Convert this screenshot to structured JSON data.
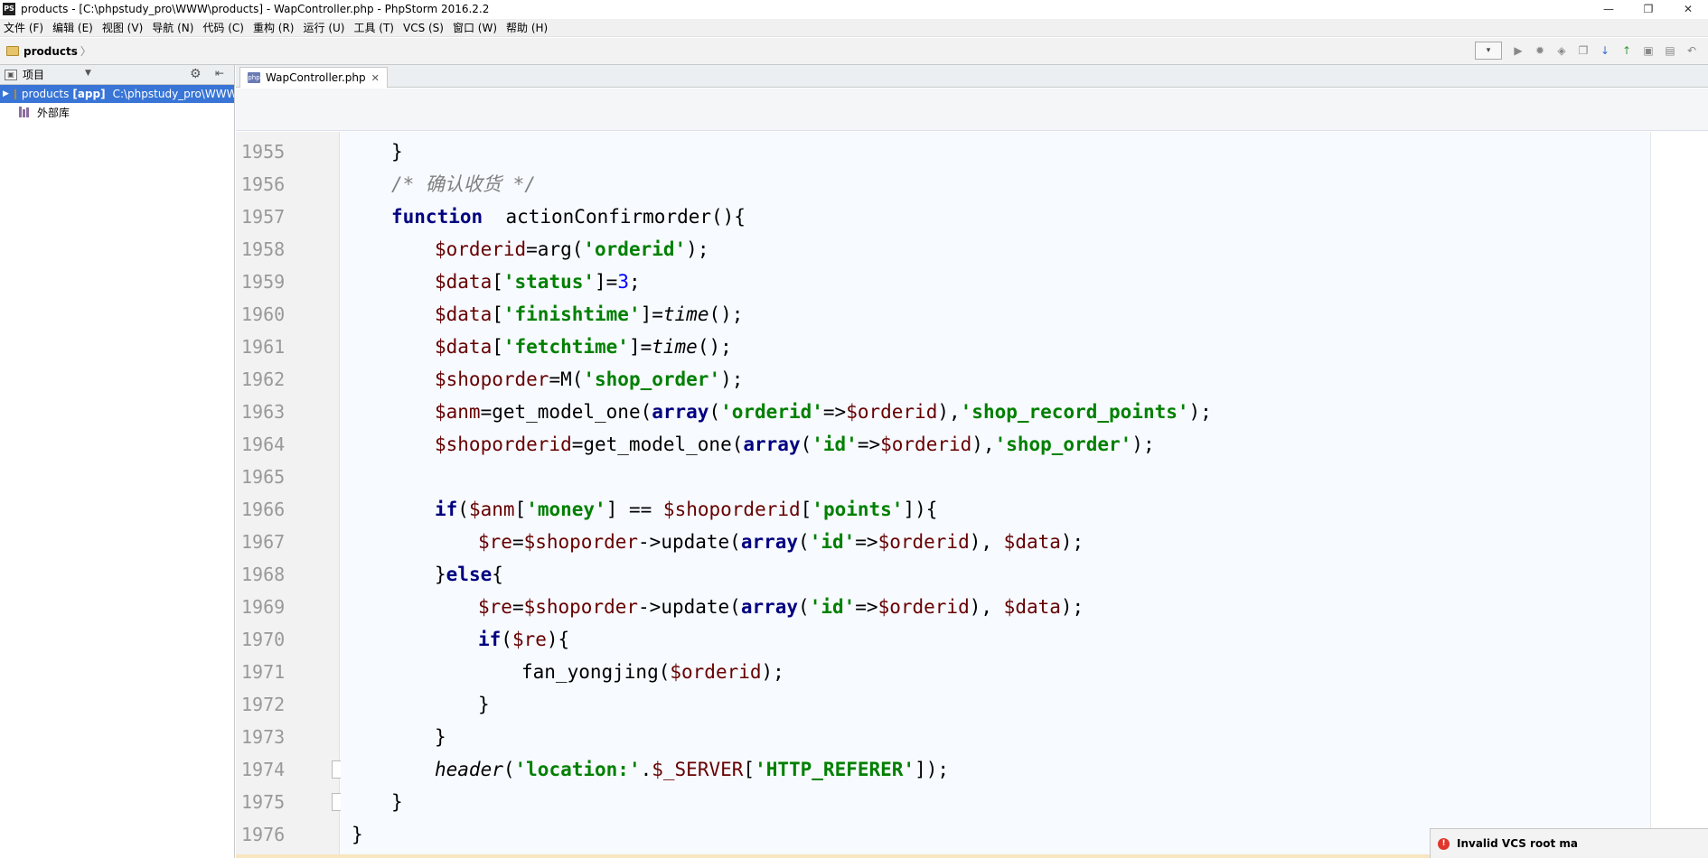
{
  "window": {
    "title": "products - [C:\\phpstudy_pro\\WWW\\products] - WapController.php - PhpStorm 2016.2.2",
    "app_icon": "PS"
  },
  "menu": [
    "文件 (F)",
    "编辑 (E)",
    "视图 (V)",
    "导航 (N)",
    "代码 (C)",
    "重构 (R)",
    "运行 (U)",
    "工具 (T)",
    "VCS (S)",
    "窗口 (W)",
    "帮助 (H)"
  ],
  "navbar": {
    "breadcrumb": "products",
    "separator": "〉"
  },
  "project_panel": {
    "title": "项目",
    "root": {
      "name": "products",
      "tag": "[app]",
      "path": "C:\\phpstudy_pro\\WWW"
    },
    "external_libs": "外部库"
  },
  "editor": {
    "tab_label": "WapController.php",
    "tab_icon": "php-file-icon"
  },
  "code": {
    "lines": [
      {
        "num": "1955",
        "indent": 1,
        "tokens": [
          {
            "t": "}",
            "c": ""
          }
        ]
      },
      {
        "num": "1956",
        "indent": 1,
        "tokens": [
          {
            "t": "/* 确认收货 */",
            "c": "cmt"
          }
        ]
      },
      {
        "num": "1957",
        "indent": 1,
        "tokens": [
          {
            "t": "function",
            "c": "kw"
          },
          {
            "t": "  actionConfirmorder(){",
            "c": ""
          }
        ]
      },
      {
        "num": "1958",
        "indent": 2,
        "tokens": [
          {
            "t": "$orderid",
            "c": "var"
          },
          {
            "t": "=arg(",
            "c": ""
          },
          {
            "t": "'orderid'",
            "c": "str"
          },
          {
            "t": ");",
            "c": ""
          }
        ]
      },
      {
        "num": "1959",
        "indent": 2,
        "tokens": [
          {
            "t": "$data",
            "c": "var"
          },
          {
            "t": "[",
            "c": ""
          },
          {
            "t": "'status'",
            "c": "str"
          },
          {
            "t": "]=",
            "c": ""
          },
          {
            "t": "3",
            "c": "num"
          },
          {
            "t": ";",
            "c": ""
          }
        ]
      },
      {
        "num": "1960",
        "indent": 2,
        "tokens": [
          {
            "t": "$data",
            "c": "var"
          },
          {
            "t": "[",
            "c": ""
          },
          {
            "t": "'finishtime'",
            "c": "str"
          },
          {
            "t": "]=",
            "c": ""
          },
          {
            "t": "time",
            "c": "it"
          },
          {
            "t": "();",
            "c": ""
          }
        ]
      },
      {
        "num": "1961",
        "indent": 2,
        "tokens": [
          {
            "t": "$data",
            "c": "var"
          },
          {
            "t": "[",
            "c": ""
          },
          {
            "t": "'fetchtime'",
            "c": "str"
          },
          {
            "t": "]=",
            "c": ""
          },
          {
            "t": "time",
            "c": "it"
          },
          {
            "t": "();",
            "c": ""
          }
        ]
      },
      {
        "num": "1962",
        "indent": 2,
        "tokens": [
          {
            "t": "$shoporder",
            "c": "var"
          },
          {
            "t": "=M(",
            "c": ""
          },
          {
            "t": "'shop_order'",
            "c": "str"
          },
          {
            "t": ");",
            "c": ""
          }
        ]
      },
      {
        "num": "1963",
        "indent": 2,
        "tokens": [
          {
            "t": "$anm",
            "c": "var"
          },
          {
            "t": "=get_model_one(",
            "c": ""
          },
          {
            "t": "array",
            "c": "kw"
          },
          {
            "t": "(",
            "c": ""
          },
          {
            "t": "'orderid'",
            "c": "str"
          },
          {
            "t": "=>",
            "c": ""
          },
          {
            "t": "$orderid",
            "c": "var"
          },
          {
            "t": "),",
            "c": ""
          },
          {
            "t": "'shop_record_points'",
            "c": "str"
          },
          {
            "t": ");",
            "c": ""
          }
        ]
      },
      {
        "num": "1964",
        "indent": 2,
        "tokens": [
          {
            "t": "$shoporderid",
            "c": "var"
          },
          {
            "t": "=get_model_one(",
            "c": ""
          },
          {
            "t": "array",
            "c": "kw"
          },
          {
            "t": "(",
            "c": ""
          },
          {
            "t": "'id'",
            "c": "str"
          },
          {
            "t": "=>",
            "c": ""
          },
          {
            "t": "$orderid",
            "c": "var"
          },
          {
            "t": "),",
            "c": ""
          },
          {
            "t": "'shop_order'",
            "c": "str"
          },
          {
            "t": ");",
            "c": ""
          }
        ]
      },
      {
        "num": "1965",
        "indent": 0,
        "tokens": []
      },
      {
        "num": "1966",
        "indent": 2,
        "tokens": [
          {
            "t": "if",
            "c": "kw"
          },
          {
            "t": "(",
            "c": ""
          },
          {
            "t": "$anm",
            "c": "var"
          },
          {
            "t": "[",
            "c": ""
          },
          {
            "t": "'money'",
            "c": "str"
          },
          {
            "t": "] == ",
            "c": ""
          },
          {
            "t": "$shoporderid",
            "c": "var"
          },
          {
            "t": "[",
            "c": ""
          },
          {
            "t": "'points'",
            "c": "str"
          },
          {
            "t": "]){",
            "c": ""
          }
        ]
      },
      {
        "num": "1967",
        "indent": 3,
        "tokens": [
          {
            "t": "$re",
            "c": "var"
          },
          {
            "t": "=",
            "c": ""
          },
          {
            "t": "$shoporder",
            "c": "var"
          },
          {
            "t": "->update(",
            "c": ""
          },
          {
            "t": "array",
            "c": "kw"
          },
          {
            "t": "(",
            "c": ""
          },
          {
            "t": "'id'",
            "c": "str"
          },
          {
            "t": "=>",
            "c": ""
          },
          {
            "t": "$orderid",
            "c": "var"
          },
          {
            "t": "), ",
            "c": ""
          },
          {
            "t": "$data",
            "c": "var"
          },
          {
            "t": ");",
            "c": ""
          }
        ]
      },
      {
        "num": "1968",
        "indent": 2,
        "tokens": [
          {
            "t": "}",
            "c": ""
          },
          {
            "t": "else",
            "c": "kw"
          },
          {
            "t": "{",
            "c": ""
          }
        ]
      },
      {
        "num": "1969",
        "indent": 3,
        "tokens": [
          {
            "t": "$re",
            "c": "var"
          },
          {
            "t": "=",
            "c": ""
          },
          {
            "t": "$shoporder",
            "c": "var"
          },
          {
            "t": "->update(",
            "c": ""
          },
          {
            "t": "array",
            "c": "kw"
          },
          {
            "t": "(",
            "c": ""
          },
          {
            "t": "'id'",
            "c": "str"
          },
          {
            "t": "=>",
            "c": ""
          },
          {
            "t": "$orderid",
            "c": "var"
          },
          {
            "t": "), ",
            "c": ""
          },
          {
            "t": "$data",
            "c": "var"
          },
          {
            "t": ");",
            "c": ""
          }
        ]
      },
      {
        "num": "1970",
        "indent": 3,
        "tokens": [
          {
            "t": "if",
            "c": "kw"
          },
          {
            "t": "(",
            "c": ""
          },
          {
            "t": "$re",
            "c": "var"
          },
          {
            "t": "){",
            "c": ""
          }
        ]
      },
      {
        "num": "1971",
        "indent": 4,
        "tokens": [
          {
            "t": "fan_yongjing(",
            "c": ""
          },
          {
            "t": "$orderid",
            "c": "var"
          },
          {
            "t": ");",
            "c": ""
          }
        ]
      },
      {
        "num": "1972",
        "indent": 3,
        "tokens": [
          {
            "t": "}",
            "c": ""
          }
        ]
      },
      {
        "num": "1973",
        "indent": 2,
        "tokens": [
          {
            "t": "}",
            "c": ""
          }
        ]
      },
      {
        "num": "1974",
        "indent": 2,
        "tokens": [
          {
            "t": "header",
            "c": "it"
          },
          {
            "t": "(",
            "c": ""
          },
          {
            "t": "'location:'",
            "c": "str"
          },
          {
            "t": ".",
            "c": ""
          },
          {
            "t": "$_SERVER",
            "c": "var"
          },
          {
            "t": "[",
            "c": ""
          },
          {
            "t": "'HTTP_REFERER'",
            "c": "str"
          },
          {
            "t": "]);",
            "c": ""
          }
        ]
      },
      {
        "num": "1975",
        "indent": 1,
        "tokens": [
          {
            "t": "}",
            "c": ""
          }
        ]
      },
      {
        "num": "1976",
        "indent": 0,
        "tokens": [
          {
            "t": "}",
            "c": ""
          }
        ]
      }
    ]
  },
  "notification": {
    "text": "Invalid VCS root ma"
  },
  "colors": {
    "selection": "#3875d6",
    "keyword": "#000080",
    "string": "#008000",
    "variable": "#660000",
    "comment": "#808080",
    "number": "#0000ff"
  }
}
